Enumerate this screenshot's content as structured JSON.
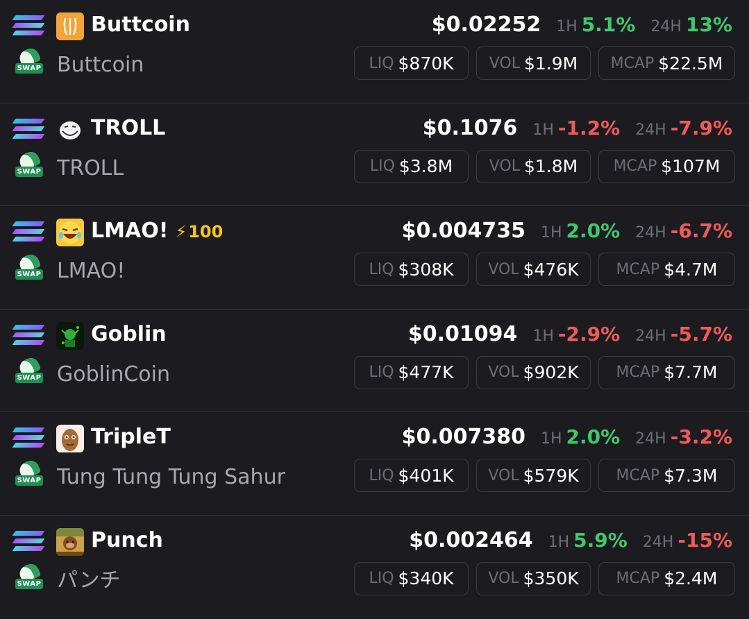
{
  "labels": {
    "h1": "1H",
    "h24": "24H",
    "liq": "LIQ",
    "vol": "VOL",
    "mcap": "MCAP",
    "swap": "SWAP"
  },
  "tokens": [
    {
      "symbol": "Buttcoin",
      "name": "Buttcoin",
      "boost": "",
      "price": "$0.02252",
      "change_1h": "5.1%",
      "change_1h_dir": "up",
      "change_24h": "13%",
      "change_24h_dir": "up",
      "liq": "$870K",
      "vol": "$1.9M",
      "mcap": "$22.5M",
      "avatar_icon": "buttcoin-avatar-icon"
    },
    {
      "symbol": "TROLL",
      "name": "TROLL",
      "boost": "",
      "price": "$0.1076",
      "change_1h": "-1.2%",
      "change_1h_dir": "down",
      "change_24h": "-7.9%",
      "change_24h_dir": "down",
      "liq": "$3.8M",
      "vol": "$1.8M",
      "mcap": "$107M",
      "avatar_icon": "trollface-avatar-icon"
    },
    {
      "symbol": "LMAO!",
      "name": "LMAO!",
      "boost": "100",
      "price": "$0.004735",
      "change_1h": "2.0%",
      "change_1h_dir": "up",
      "change_24h": "-6.7%",
      "change_24h_dir": "down",
      "liq": "$308K",
      "vol": "$476K",
      "mcap": "$4.7M",
      "avatar_icon": "laughing-emoji-avatar-icon"
    },
    {
      "symbol": "Goblin",
      "name": "GoblinCoin",
      "boost": "",
      "price": "$0.01094",
      "change_1h": "-2.9%",
      "change_1h_dir": "down",
      "change_24h": "-5.7%",
      "change_24h_dir": "down",
      "liq": "$477K",
      "vol": "$902K",
      "mcap": "$7.7M",
      "avatar_icon": "goblin-avatar-icon"
    },
    {
      "symbol": "TripleT",
      "name": "Tung Tung Tung Sahur",
      "boost": "",
      "price": "$0.007380",
      "change_1h": "2.0%",
      "change_1h_dir": "up",
      "change_24h": "-3.2%",
      "change_24h_dir": "down",
      "liq": "$401K",
      "vol": "$579K",
      "mcap": "$7.3M",
      "avatar_icon": "wooden-figure-avatar-icon"
    },
    {
      "symbol": "Punch",
      "name": "パンチ",
      "boost": "",
      "price": "$0.002464",
      "change_1h": "5.9%",
      "change_1h_dir": "up",
      "change_24h": "-15%",
      "change_24h_dir": "down",
      "liq": "$340K",
      "vol": "$350K",
      "mcap": "$2.4M",
      "avatar_icon": "monkey-avatar-icon"
    }
  ],
  "colors": {
    "background": "#1c1c20",
    "up": "#3fc86c",
    "down": "#ef5a5a",
    "boost": "#f5c518",
    "muted": "#6d6d74"
  }
}
